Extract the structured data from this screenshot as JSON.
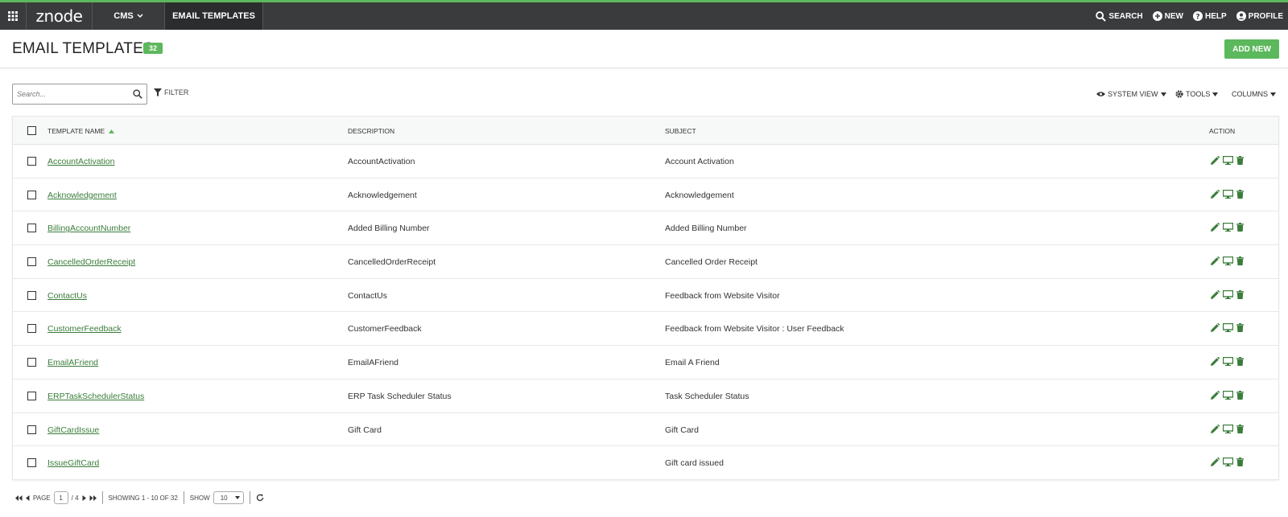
{
  "topbar": {
    "logo": "znode",
    "cms_label": "CMS",
    "active_tab": "EMAIL TEMPLATES",
    "search_label": "SEARCH",
    "new_label": "NEW",
    "help_label": "HELP",
    "profile_label": "PROFILE",
    "accent_color": "#5cb85c",
    "background_color": "#3a3b3c"
  },
  "header": {
    "title": "EMAIL TEMPLATES",
    "count": "32",
    "add_new_label": "ADD NEW"
  },
  "toolbar": {
    "search_placeholder": "Search...",
    "filter_label": "FILTER",
    "system_view_label": "SYSTEM VIEW",
    "tools_label": "TOOLS",
    "columns_label": "COLUMNS"
  },
  "grid": {
    "columns": [
      "TEMPLATE NAME",
      "DESCRIPTION",
      "SUBJECT",
      "ACTION"
    ],
    "sort_column": "TEMPLATE NAME",
    "sort_direction": "asc",
    "rows": [
      {
        "name": "AccountActivation",
        "description": "AccountActivation",
        "subject": "Account Activation"
      },
      {
        "name": "Acknowledgement",
        "description": "Acknowledgement",
        "subject": "Acknowledgement"
      },
      {
        "name": "BillingAccountNumber",
        "description": "Added Billing Number",
        "subject": "Added Billing Number"
      },
      {
        "name": "CancelledOrderReceipt",
        "description": "CancelledOrderReceipt",
        "subject": "Cancelled Order Receipt"
      },
      {
        "name": "ContactUs",
        "description": "ContactUs",
        "subject": "Feedback from Website Visitor"
      },
      {
        "name": "CustomerFeedback",
        "description": "CustomerFeedback",
        "subject": "Feedback from Website Visitor : User Feedback"
      },
      {
        "name": "EmailAFriend",
        "description": "EmailAFriend",
        "subject": "Email A Friend"
      },
      {
        "name": "ERPTaskSchedulerStatus",
        "description": "ERP Task Scheduler Status",
        "subject": "Task Scheduler Status"
      },
      {
        "name": "GiftCardIssue",
        "description": "Gift Card",
        "subject": "Gift Card"
      },
      {
        "name": "IssueGiftCard",
        "description": "",
        "subject": "Gift card issued"
      }
    ],
    "action_icons": [
      "edit-icon",
      "preview-icon",
      "delete-icon"
    ]
  },
  "pager": {
    "page_label": "PAGE",
    "current_page": "1",
    "total_pages": "/ 4",
    "showing": "SHOWING 1 - 10 OF 32",
    "show_label": "SHOW",
    "page_size": "10"
  }
}
